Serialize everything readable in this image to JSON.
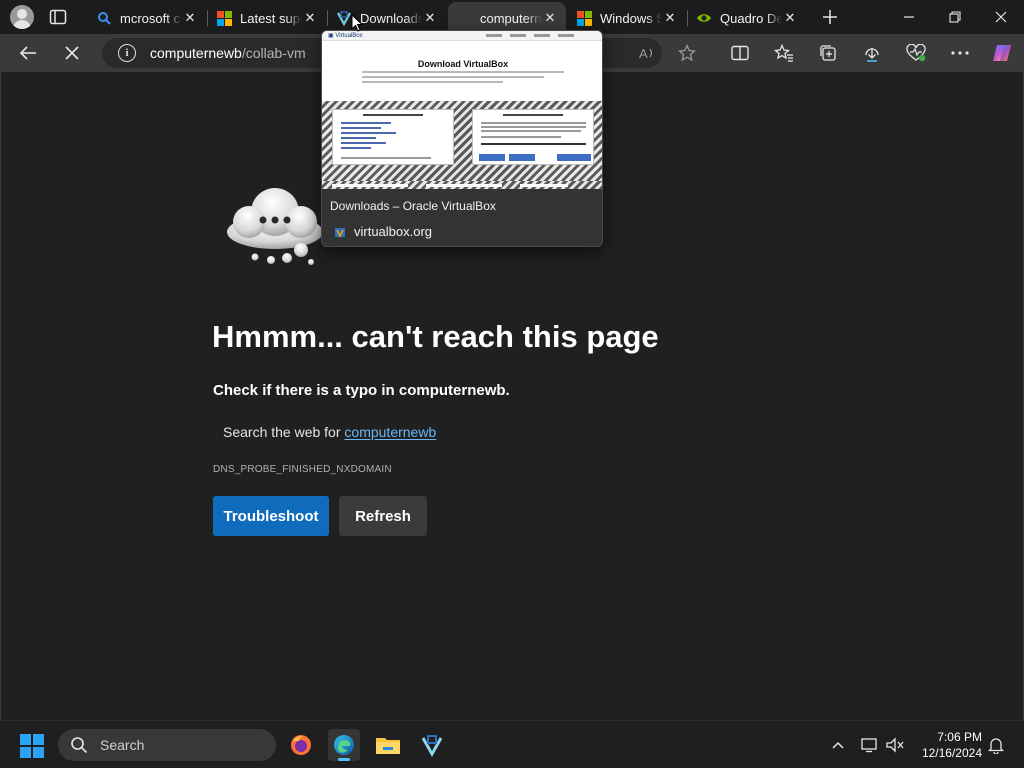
{
  "browser": {
    "tabs": [
      {
        "title": "mcrosoft c",
        "favicon": "bing-search-icon",
        "active": false
      },
      {
        "title": "Latest supp",
        "favicon": "microsoft-logo-icon",
        "active": false
      },
      {
        "title": "Downloads",
        "favicon": "virtualbox-icon",
        "active": false
      },
      {
        "title": "computern",
        "favicon": "none",
        "active": true
      },
      {
        "title": "Windows S",
        "favicon": "microsoft-logo-icon",
        "active": false
      },
      {
        "title": "Quadro De",
        "favicon": "nvidia-icon",
        "active": false
      }
    ],
    "address": {
      "host": "computernewb",
      "path": "/collab-vm"
    },
    "colors": {
      "accent": "#0f6cbd",
      "link": "#6ab6f7",
      "background": "#202020"
    }
  },
  "tab_preview": {
    "page_title": "Downloads – Oracle VirtualBox",
    "site": "virtualbox.org",
    "thumbnail_heading": "Download VirtualBox"
  },
  "error_page": {
    "heading": "Hmmm... can't reach this page",
    "check_text": "Check if there is a typo in computernewb.",
    "search_prefix": "Search the web for ",
    "search_link": "computernewb",
    "error_code": "DNS_PROBE_FINISHED_NXDOMAIN",
    "primary_button": "Troubleshoot",
    "secondary_button": "Refresh"
  },
  "taskbar": {
    "search_label": "Search",
    "time": "7:06 PM",
    "date": "12/16/2024",
    "pinned": [
      "firefox-icon",
      "edge-icon",
      "file-explorer-icon",
      "virtualbox-icon"
    ]
  }
}
